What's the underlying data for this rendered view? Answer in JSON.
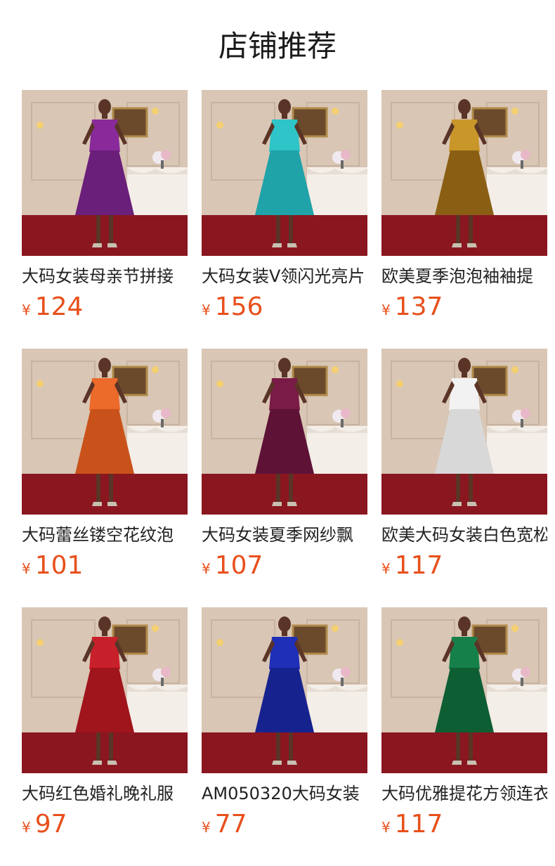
{
  "header": {
    "title": "店铺推荐"
  },
  "currency_symbol": "¥",
  "products": [
    {
      "name": "大码女装母亲节拼接",
      "price": "124",
      "dress_color": "#8a2a9a",
      "dress_color2": "#6a1f7a",
      "icon": "dress-photo"
    },
    {
      "name": "大码女装V领闪光亮片",
      "price": "156",
      "dress_color": "#2ec4c8",
      "dress_color2": "#1fa2a8",
      "icon": "dress-photo"
    },
    {
      "name": "欧美夏季泡泡袖袖提",
      "price": "137",
      "dress_color": "#c9962a",
      "dress_color2": "#8a5f14",
      "icon": "dress-photo"
    },
    {
      "name": "大码蕾丝镂空花纹泡",
      "price": "101",
      "dress_color": "#ec6a2a",
      "dress_color2": "#c9521a",
      "icon": "dress-photo"
    },
    {
      "name": "大码女装夏季网纱飘",
      "price": "107",
      "dress_color": "#7a1a46",
      "dress_color2": "#5e1236",
      "icon": "dress-photo"
    },
    {
      "name": "欧美大码女装白色宽松",
      "price": "117",
      "dress_color": "#f2f2f2",
      "dress_color2": "#d8d8d8",
      "icon": "dress-photo"
    },
    {
      "name": "大码红色婚礼晚礼服",
      "price": "97",
      "dress_color": "#c8202a",
      "dress_color2": "#a0141c",
      "icon": "dress-photo"
    },
    {
      "name": "AM050320大码女装",
      "price": "77",
      "dress_color": "#1f2fb8",
      "dress_color2": "#16238e",
      "icon": "dress-photo"
    },
    {
      "name": "大码优雅提花方领连衣",
      "price": "117",
      "dress_color": "#16804a",
      "dress_color2": "#0e5e34",
      "icon": "dress-photo"
    }
  ],
  "colors": {
    "price": "#e8501c",
    "wall": "#d9c6b4",
    "carpet": "#8a1620",
    "table": "#f4eee8",
    "skin": "#5a3426"
  }
}
